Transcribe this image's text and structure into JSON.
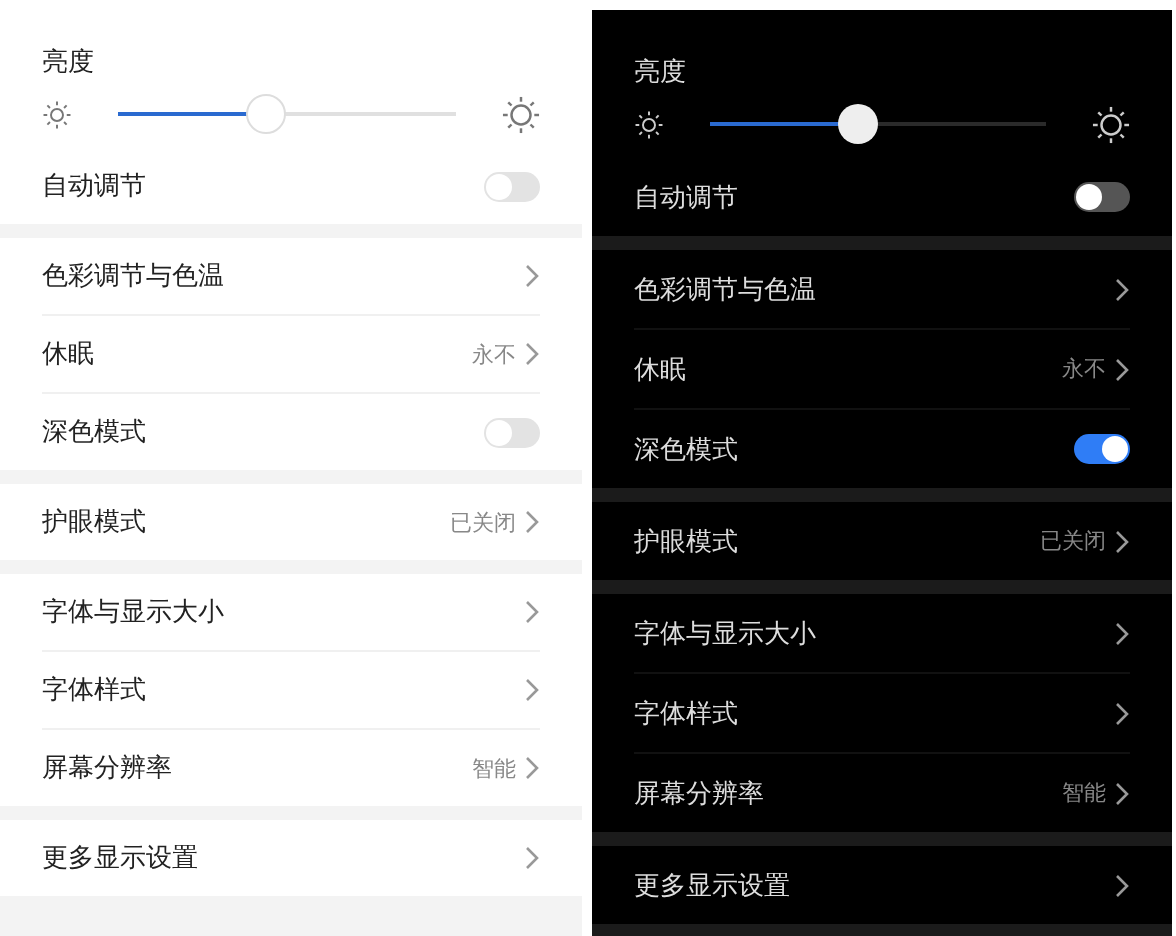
{
  "panels": [
    {
      "kind": "light",
      "groups": [
        {
          "items": [
            {
              "kind": "slider",
              "label": "亮度",
              "level": 0.44
            },
            {
              "kind": "toggle",
              "label": "自动调节",
              "on": false
            }
          ]
        },
        {
          "items": [
            {
              "kind": "link",
              "label": "色彩调节与色温"
            },
            {
              "kind": "link",
              "label": "休眠",
              "value": "永不"
            },
            {
              "kind": "toggle",
              "label": "深色模式",
              "on": false
            }
          ]
        },
        {
          "items": [
            {
              "kind": "link",
              "label": "护眼模式",
              "value": "已关闭"
            }
          ]
        },
        {
          "items": [
            {
              "kind": "link",
              "label": "字体与显示大小"
            },
            {
              "kind": "link",
              "label": "字体样式"
            },
            {
              "kind": "link",
              "label": "屏幕分辨率",
              "value": "智能"
            }
          ]
        },
        {
          "items": [
            {
              "kind": "link",
              "label": "更多显示设置"
            }
          ]
        }
      ]
    },
    {
      "kind": "dark",
      "groups": [
        {
          "items": [
            {
              "kind": "slider",
              "label": "亮度",
              "level": 0.44
            },
            {
              "kind": "toggle",
              "label": "自动调节",
              "on": false
            }
          ]
        },
        {
          "items": [
            {
              "kind": "link",
              "label": "色彩调节与色温"
            },
            {
              "kind": "link",
              "label": "休眠",
              "value": "永不"
            },
            {
              "kind": "toggle",
              "label": "深色模式",
              "on": true
            }
          ]
        },
        {
          "items": [
            {
              "kind": "link",
              "label": "护眼模式",
              "value": "已关闭"
            }
          ]
        },
        {
          "items": [
            {
              "kind": "link",
              "label": "字体与显示大小"
            },
            {
              "kind": "link",
              "label": "字体样式"
            },
            {
              "kind": "link",
              "label": "屏幕分辨率",
              "value": "智能"
            }
          ]
        },
        {
          "items": [
            {
              "kind": "link",
              "label": "更多显示设置"
            }
          ]
        }
      ]
    }
  ]
}
